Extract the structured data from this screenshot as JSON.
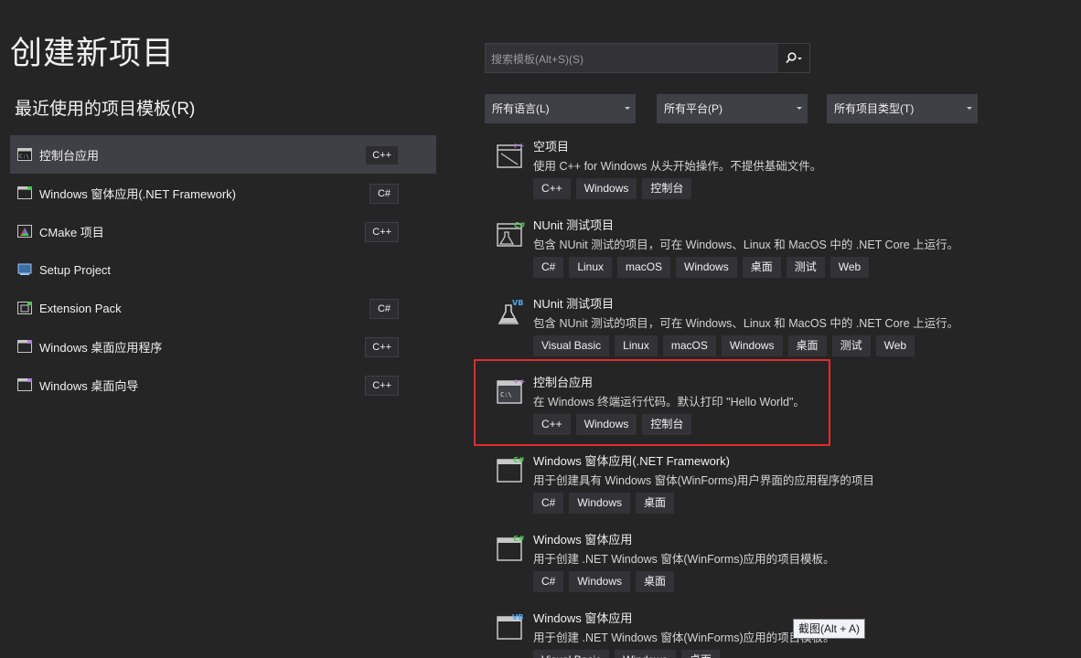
{
  "page": {
    "title": "创建新项目",
    "recent_heading": "最近使用的项目模板(R)"
  },
  "recent": [
    {
      "label": "控制台应用",
      "tag": "C++",
      "icon": "console-app-icon"
    },
    {
      "label": "Windows 窗体应用(.NET Framework)",
      "tag": "C#",
      "icon": "windows-forms-icon"
    },
    {
      "label": "CMake 项目",
      "tag": "C++",
      "icon": "cmake-icon"
    },
    {
      "label": "Setup Project",
      "tag": "",
      "icon": "setup-project-icon"
    },
    {
      "label": "Extension Pack",
      "tag": "C#",
      "icon": "extension-pack-icon"
    },
    {
      "label": "Windows 桌面应用程序",
      "tag": "C++",
      "icon": "desktop-app-icon"
    },
    {
      "label": "Windows 桌面向导",
      "tag": "C++",
      "icon": "desktop-wizard-icon"
    }
  ],
  "search": {
    "placeholder": "搜索模板(Alt+S)(S)"
  },
  "filters": {
    "language": "所有语言(L)",
    "platform": "所有平台(P)",
    "project_type": "所有项目类型(T)"
  },
  "templates": [
    {
      "name": "空项目",
      "desc": "使用 C++ for Windows 从头开始操作。不提供基础文件。",
      "tags": [
        "C++",
        "Windows",
        "控制台"
      ],
      "icon": "empty-project-icon",
      "badge": "++"
    },
    {
      "name": "NUnit 测试项目",
      "desc": "包含 NUnit 测试的项目，可在 Windows、Linux 和 MacOS 中的 .NET Core 上运行。",
      "tags": [
        "C#",
        "Linux",
        "macOS",
        "Windows",
        "桌面",
        "测试",
        "Web"
      ],
      "icon": "nunit-csharp-icon",
      "badge": "C#"
    },
    {
      "name": "NUnit 测试项目",
      "desc": "包含 NUnit 测试的项目，可在 Windows、Linux 和 MacOS 中的 .NET Core 上运行。",
      "tags": [
        "Visual Basic",
        "Linux",
        "macOS",
        "Windows",
        "桌面",
        "测试",
        "Web"
      ],
      "icon": "nunit-vb-icon",
      "badge": "VB"
    },
    {
      "name": "控制台应用",
      "desc": "在 Windows 终端运行代码。默认打印 \"Hello World\"。",
      "tags": [
        "C++",
        "Windows",
        "控制台"
      ],
      "icon": "console-app-icon",
      "badge": "++"
    },
    {
      "name": "Windows 窗体应用(.NET Framework)",
      "desc": "用于创建具有 Windows 窗体(WinForms)用户界面的应用程序的项目",
      "tags": [
        "C#",
        "Windows",
        "桌面"
      ],
      "icon": "windows-forms-icon",
      "badge": "C#"
    },
    {
      "name": "Windows 窗体应用",
      "desc": "用于创建 .NET Windows 窗体(WinForms)应用的项目模板。",
      "tags": [
        "C#",
        "Windows",
        "桌面"
      ],
      "icon": "windows-forms-icon",
      "badge": "C#"
    },
    {
      "name": "Windows 窗体应用",
      "desc": "用于创建 .NET Windows 窗体(WinForms)应用的项目模板。",
      "tags": [
        "Visual Basic",
        "Windows",
        "桌面"
      ],
      "icon": "windows-forms-vb-icon",
      "badge": "VB"
    }
  ],
  "tooltip": "截图(Alt + A)",
  "colors": {
    "background": "#252526",
    "selected": "#3f3f46",
    "highlight_border": "#e12c2c",
    "cpp_badge": "#b180d7",
    "csharp_badge": "#4ec94e",
    "vb_badge": "#4fa8f0"
  }
}
